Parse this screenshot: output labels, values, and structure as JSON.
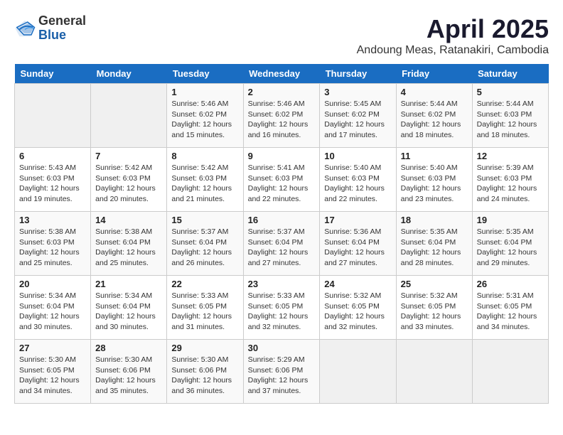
{
  "header": {
    "logo": {
      "general": "General",
      "blue": "Blue"
    },
    "title": "April 2025",
    "location": "Andoung Meas, Ratanakiri, Cambodia"
  },
  "calendar": {
    "weekdays": [
      "Sunday",
      "Monday",
      "Tuesday",
      "Wednesday",
      "Thursday",
      "Friday",
      "Saturday"
    ],
    "weeks": [
      [
        {
          "day": "",
          "info": ""
        },
        {
          "day": "",
          "info": ""
        },
        {
          "day": "1",
          "info": "Sunrise: 5:46 AM\nSunset: 6:02 PM\nDaylight: 12 hours and 15 minutes."
        },
        {
          "day": "2",
          "info": "Sunrise: 5:46 AM\nSunset: 6:02 PM\nDaylight: 12 hours and 16 minutes."
        },
        {
          "day": "3",
          "info": "Sunrise: 5:45 AM\nSunset: 6:02 PM\nDaylight: 12 hours and 17 minutes."
        },
        {
          "day": "4",
          "info": "Sunrise: 5:44 AM\nSunset: 6:02 PM\nDaylight: 12 hours and 18 minutes."
        },
        {
          "day": "5",
          "info": "Sunrise: 5:44 AM\nSunset: 6:03 PM\nDaylight: 12 hours and 18 minutes."
        }
      ],
      [
        {
          "day": "6",
          "info": "Sunrise: 5:43 AM\nSunset: 6:03 PM\nDaylight: 12 hours and 19 minutes."
        },
        {
          "day": "7",
          "info": "Sunrise: 5:42 AM\nSunset: 6:03 PM\nDaylight: 12 hours and 20 minutes."
        },
        {
          "day": "8",
          "info": "Sunrise: 5:42 AM\nSunset: 6:03 PM\nDaylight: 12 hours and 21 minutes."
        },
        {
          "day": "9",
          "info": "Sunrise: 5:41 AM\nSunset: 6:03 PM\nDaylight: 12 hours and 22 minutes."
        },
        {
          "day": "10",
          "info": "Sunrise: 5:40 AM\nSunset: 6:03 PM\nDaylight: 12 hours and 22 minutes."
        },
        {
          "day": "11",
          "info": "Sunrise: 5:40 AM\nSunset: 6:03 PM\nDaylight: 12 hours and 23 minutes."
        },
        {
          "day": "12",
          "info": "Sunrise: 5:39 AM\nSunset: 6:03 PM\nDaylight: 12 hours and 24 minutes."
        }
      ],
      [
        {
          "day": "13",
          "info": "Sunrise: 5:38 AM\nSunset: 6:03 PM\nDaylight: 12 hours and 25 minutes."
        },
        {
          "day": "14",
          "info": "Sunrise: 5:38 AM\nSunset: 6:04 PM\nDaylight: 12 hours and 25 minutes."
        },
        {
          "day": "15",
          "info": "Sunrise: 5:37 AM\nSunset: 6:04 PM\nDaylight: 12 hours and 26 minutes."
        },
        {
          "day": "16",
          "info": "Sunrise: 5:37 AM\nSunset: 6:04 PM\nDaylight: 12 hours and 27 minutes."
        },
        {
          "day": "17",
          "info": "Sunrise: 5:36 AM\nSunset: 6:04 PM\nDaylight: 12 hours and 27 minutes."
        },
        {
          "day": "18",
          "info": "Sunrise: 5:35 AM\nSunset: 6:04 PM\nDaylight: 12 hours and 28 minutes."
        },
        {
          "day": "19",
          "info": "Sunrise: 5:35 AM\nSunset: 6:04 PM\nDaylight: 12 hours and 29 minutes."
        }
      ],
      [
        {
          "day": "20",
          "info": "Sunrise: 5:34 AM\nSunset: 6:04 PM\nDaylight: 12 hours and 30 minutes."
        },
        {
          "day": "21",
          "info": "Sunrise: 5:34 AM\nSunset: 6:04 PM\nDaylight: 12 hours and 30 minutes."
        },
        {
          "day": "22",
          "info": "Sunrise: 5:33 AM\nSunset: 6:05 PM\nDaylight: 12 hours and 31 minutes."
        },
        {
          "day": "23",
          "info": "Sunrise: 5:33 AM\nSunset: 6:05 PM\nDaylight: 12 hours and 32 minutes."
        },
        {
          "day": "24",
          "info": "Sunrise: 5:32 AM\nSunset: 6:05 PM\nDaylight: 12 hours and 32 minutes."
        },
        {
          "day": "25",
          "info": "Sunrise: 5:32 AM\nSunset: 6:05 PM\nDaylight: 12 hours and 33 minutes."
        },
        {
          "day": "26",
          "info": "Sunrise: 5:31 AM\nSunset: 6:05 PM\nDaylight: 12 hours and 34 minutes."
        }
      ],
      [
        {
          "day": "27",
          "info": "Sunrise: 5:30 AM\nSunset: 6:05 PM\nDaylight: 12 hours and 34 minutes."
        },
        {
          "day": "28",
          "info": "Sunrise: 5:30 AM\nSunset: 6:06 PM\nDaylight: 12 hours and 35 minutes."
        },
        {
          "day": "29",
          "info": "Sunrise: 5:30 AM\nSunset: 6:06 PM\nDaylight: 12 hours and 36 minutes."
        },
        {
          "day": "30",
          "info": "Sunrise: 5:29 AM\nSunset: 6:06 PM\nDaylight: 12 hours and 37 minutes."
        },
        {
          "day": "",
          "info": ""
        },
        {
          "day": "",
          "info": ""
        },
        {
          "day": "",
          "info": ""
        }
      ]
    ]
  }
}
